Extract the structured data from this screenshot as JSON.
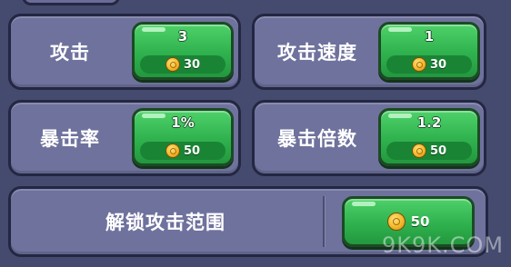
{
  "stats": [
    {
      "label": "攻击",
      "value": "3",
      "cost": "30"
    },
    {
      "label": "攻击速度",
      "value": "1",
      "cost": "30"
    },
    {
      "label": "暴击率",
      "value": "1%",
      "cost": "50"
    },
    {
      "label": "暴击倍数",
      "value": "1.2",
      "cost": "50"
    }
  ],
  "unlock": {
    "label": "解锁攻击范围",
    "cost": "50"
  },
  "watermark": "9K9K.COM",
  "colors": {
    "background": "#454b6e",
    "panel": "#6f729d",
    "outline": "#232742",
    "button_green": "#2fb24e",
    "coin_gold": "#f2b82c"
  },
  "icons": {
    "currency": "gold-coin-icon"
  }
}
